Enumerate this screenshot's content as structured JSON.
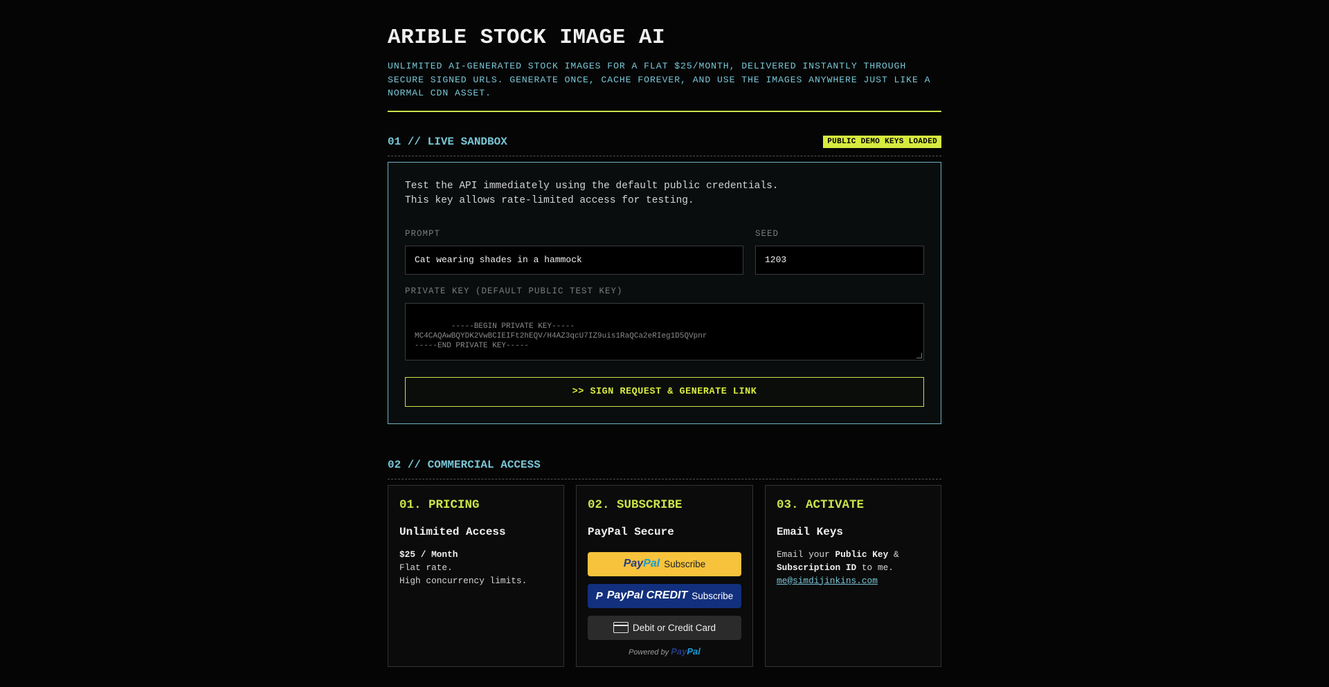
{
  "header": {
    "title": "ARIBLE STOCK IMAGE AI",
    "subtitle": "UNLIMITED AI-GENERATED STOCK IMAGES FOR A FLAT $25/MONTH, DELIVERED INSTANTLY THROUGH SECURE SIGNED URLS. GENERATE ONCE, CACHE FOREVER, AND USE THE IMAGES ANYWHERE JUST LIKE A NORMAL CDN ASSET."
  },
  "sandbox": {
    "section_title": "01 // LIVE SANDBOX",
    "badge": "PUBLIC DEMO KEYS LOADED",
    "intro_line1": "Test the API immediately using the default public credentials.",
    "intro_line2": "This key allows rate-limited access for testing.",
    "prompt_label": "PROMPT",
    "prompt_value": "Cat wearing shades in a hammock",
    "seed_label": "SEED",
    "seed_value": "1203",
    "key_label": "PRIVATE KEY (DEFAULT PUBLIC TEST KEY)",
    "key_value": "-----BEGIN PRIVATE KEY-----\nMC4CAQAwBQYDK2VwBCIEIFt2hEQV/H4AZ3qcU7IZ9uis1RaQCa2eRIeg1D5QVpnr\n-----END PRIVATE KEY-----",
    "generate_label": ">> SIGN REQUEST & GENERATE LINK"
  },
  "commercial": {
    "section_title": "02 // COMMERCIAL ACCESS",
    "pricing": {
      "title": "01. PRICING",
      "subtitle": "Unlimited Access",
      "price": "$25 / Month",
      "line1": "Flat rate.",
      "line2": "High concurrency limits."
    },
    "subscribe": {
      "title": "02. SUBSCRIBE",
      "subtitle": "PayPal Secure",
      "paypal_logo_a": "Pay",
      "paypal_logo_b": "Pal",
      "paypal_label": "Subscribe",
      "credit_logo": "PayPal CREDIT",
      "credit_label": "Subscribe",
      "card_label": "Debit or Credit Card",
      "powered_by": "Powered by",
      "powered_logo_a": "Pay",
      "powered_logo_b": "Pal"
    },
    "activate": {
      "title": "03. ACTIVATE",
      "subtitle": "Email Keys",
      "text_a": "Email your ",
      "text_b": "Public Key",
      "text_c": " &",
      "text_d": "Subscription ID",
      "text_e": " to me.",
      "email": "me@simdijinkins.com"
    }
  },
  "colors": {
    "accent": "#cbe34a",
    "cyan": "#79c6d6",
    "background": "#050505"
  }
}
